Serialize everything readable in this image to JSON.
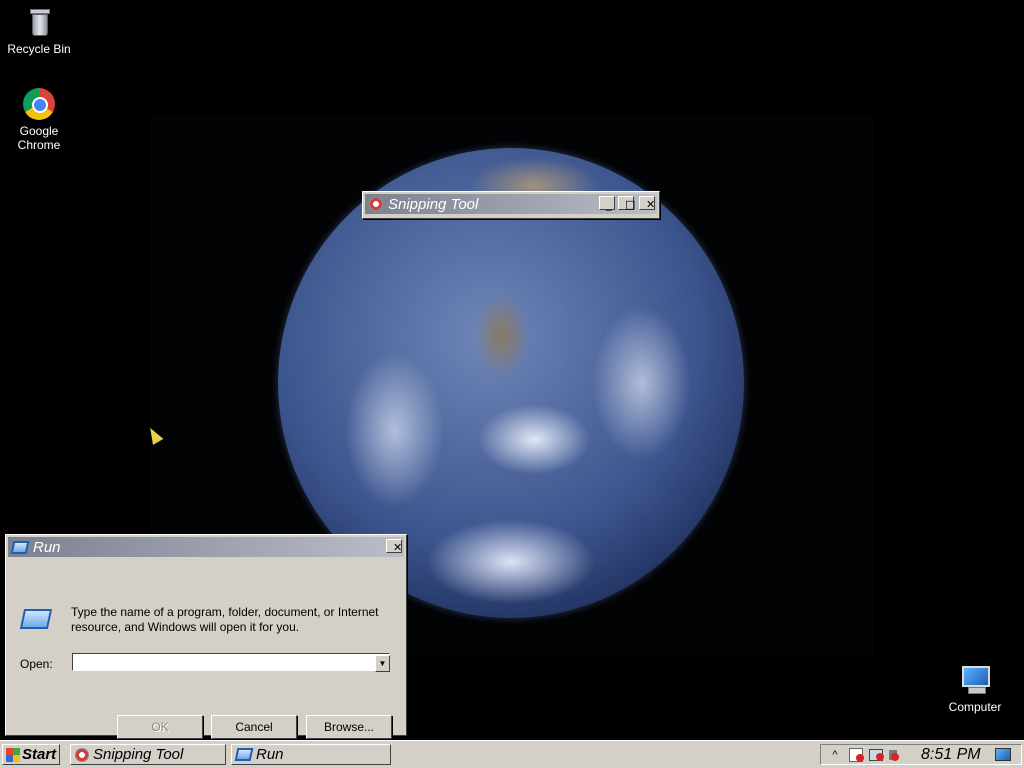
{
  "desktop": {
    "icons": [
      {
        "label": "Recycle Bin",
        "icon": "recycle-bin-icon"
      },
      {
        "label": "Google Chrome",
        "icon": "chrome-icon"
      },
      {
        "label": "Computer",
        "icon": "computer-icon"
      }
    ]
  },
  "snipping_tool": {
    "title": "Snipping Tool",
    "minimize": "_",
    "maximize": "□",
    "close": "✕"
  },
  "run_dialog": {
    "title": "Run",
    "close": "✕",
    "description": "Type the name of a program, folder, document, or Internet resource, and Windows will open it for you.",
    "open_label": "Open:",
    "open_value": "",
    "dropdown_arrow": "▼",
    "ok_label": "OK",
    "cancel_label": "Cancel",
    "browse_label": "Browse..."
  },
  "taskbar": {
    "start_label": "Start",
    "tasks": [
      {
        "label": "Snipping Tool"
      },
      {
        "label": "Run"
      }
    ],
    "tray": {
      "show_hidden": "^",
      "clock": "8:51 PM"
    }
  },
  "colors": {
    "desktop_bg": "#000000",
    "window_face": "#d4d0c8",
    "titlebar_start": "#7b8190",
    "titlebar_end": "#b9bec8"
  }
}
